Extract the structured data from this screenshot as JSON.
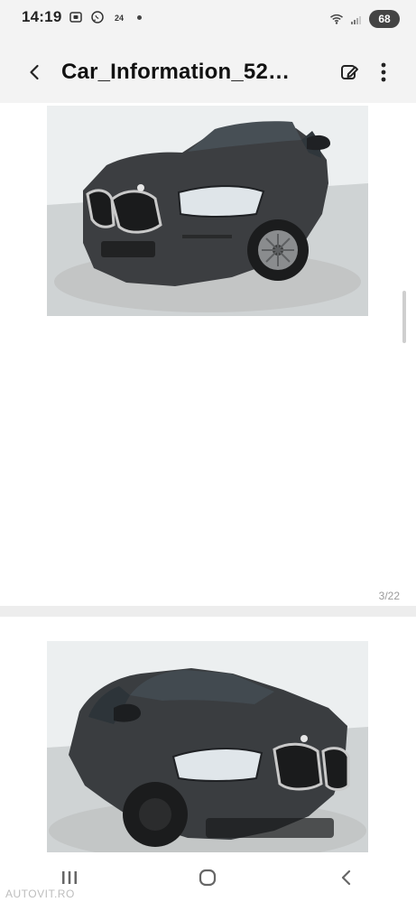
{
  "status_bar": {
    "time": "14:19",
    "network_speed_label": "24",
    "battery_level": "68",
    "icons": [
      "screenshot-icon",
      "whatsapp-icon",
      "speed-indicator-icon",
      "notification-dot",
      "wifi-icon",
      "signal-icon",
      "battery-icon"
    ]
  },
  "header": {
    "title": "Car_Information_52…",
    "back_icon": "back-chevron-icon",
    "edit_icon": "edit-icon",
    "more_icon": "more-vertical-icon"
  },
  "viewer": {
    "page_counter": "3/22"
  },
  "navigation": {
    "icons": [
      "recent-apps-icon",
      "home-icon",
      "back-nav-icon"
    ],
    "watermark": "AUTOVIT.RO"
  },
  "colors": {
    "status_bg": "#f3f3f3",
    "divider_bg": "#ededed"
  }
}
